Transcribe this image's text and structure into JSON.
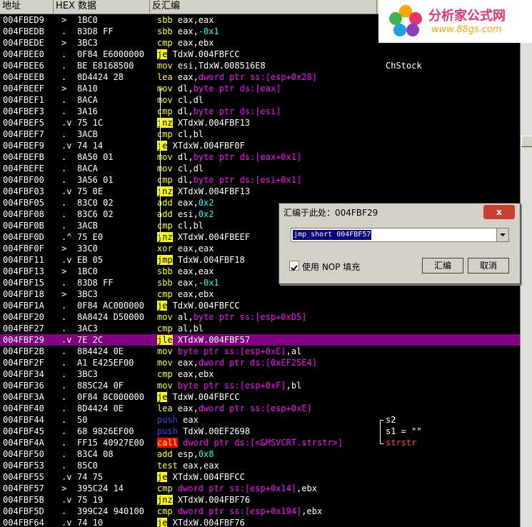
{
  "columns": {
    "address": "地址",
    "hex": "HEX 数据",
    "disasm": "反汇编",
    "comment": "注"
  },
  "logo": {
    "title": "分析家公式网",
    "url": "www.88gs.com"
  },
  "rows": [
    {
      "addr": "004FBED9",
      "mark": ">",
      "hex": "1BC0",
      "dis": [
        [
          "sbb ",
          "m"
        ],
        [
          "eax,eax",
          "w"
        ]
      ],
      "cmt": ""
    },
    {
      "addr": "004FBEDB",
      "mark": ".",
      "hex": "83D8 FF",
      "dis": [
        [
          "sbb ",
          "m"
        ],
        [
          "eax,",
          "w"
        ],
        [
          "-0x1",
          "n"
        ]
      ],
      "cmt": ""
    },
    {
      "addr": "004FBEDE",
      "mark": ">",
      "hex": "3BC3",
      "dis": [
        [
          "cmp ",
          "m"
        ],
        [
          "eax,ebx",
          "w"
        ]
      ],
      "cmt": ""
    },
    {
      "addr": "004FBEE0",
      "mark": ".",
      "hex": "0F84 E6000000",
      "dis": [
        [
          "je",
          "j"
        ],
        [
          " TdxW.004FBFCC",
          "w"
        ]
      ],
      "cmt": ""
    },
    {
      "addr": "004FBEE6",
      "mark": ".",
      "hex": "BE E8168500",
      "dis": [
        [
          "mov ",
          "m"
        ],
        [
          "esi,TdxW.008516E8",
          "w"
        ]
      ],
      "cmt": "ChStock"
    },
    {
      "addr": "004FBEEB",
      "mark": ".",
      "hex": "8D4424 28",
      "dis": [
        [
          "lea ",
          "m"
        ],
        [
          "eax,",
          "w"
        ],
        [
          "dword ptr ss:[esp+0x28]",
          "p"
        ]
      ],
      "cmt": ""
    },
    {
      "addr": "004FBEEF",
      "mark": ">",
      "hex": "8A10",
      "dis": [
        [
          "mov ",
          "m"
        ],
        [
          "dl,",
          "w"
        ],
        [
          "byte ptr ds:[eax]",
          "p"
        ]
      ],
      "cmt": ""
    },
    {
      "addr": "004FBEF1",
      "mark": ".",
      "hex": "8ACA",
      "dis": [
        [
          "mov ",
          "m"
        ],
        [
          "cl,dl",
          "w"
        ]
      ],
      "cmt": ""
    },
    {
      "addr": "004FBEF3",
      "mark": ".",
      "hex": "3A16",
      "dis": [
        [
          "cmp ",
          "m"
        ],
        [
          "dl,",
          "w"
        ],
        [
          "byte ptr ds:[esi]",
          "p"
        ]
      ],
      "cmt": ""
    },
    {
      "addr": "004FBEF5",
      "mark": ".v",
      "hex": "75 1C",
      "dis": [
        [
          "jnz",
          "j"
        ],
        [
          " XTdxW.004FBF13",
          "w"
        ]
      ],
      "cmt": ""
    },
    {
      "addr": "004FBEF7",
      "mark": ".",
      "hex": "3ACB",
      "dis": [
        [
          "cmp ",
          "m"
        ],
        [
          "cl,bl",
          "w"
        ]
      ],
      "cmt": ""
    },
    {
      "addr": "004FBEF9",
      "mark": ".v",
      "hex": "74 14",
      "dis": [
        [
          "je",
          "j"
        ],
        [
          " XTdxW.004FBF0F",
          "w"
        ]
      ],
      "cmt": ""
    },
    {
      "addr": "004FBEFB",
      "mark": ".",
      "hex": "8A50 01",
      "dis": [
        [
          "mov ",
          "m"
        ],
        [
          "dl,",
          "w"
        ],
        [
          "byte ptr ds:[eax+0x1]",
          "p"
        ]
      ],
      "cmt": ""
    },
    {
      "addr": "004FBEFE",
      "mark": ".",
      "hex": "8ACA",
      "dis": [
        [
          "mov ",
          "m"
        ],
        [
          "cl,dl",
          "w"
        ]
      ],
      "cmt": ""
    },
    {
      "addr": "004FBF00",
      "mark": ".",
      "hex": "3A56 01",
      "dis": [
        [
          "cmp ",
          "m"
        ],
        [
          "dl,",
          "w"
        ],
        [
          "byte ptr ds:[esi+0x1]",
          "p"
        ]
      ],
      "cmt": ""
    },
    {
      "addr": "004FBF03",
      "mark": ".v",
      "hex": "75 0E",
      "dis": [
        [
          "jnz",
          "j"
        ],
        [
          " XTdxW.004FBF13",
          "w"
        ]
      ],
      "cmt": ""
    },
    {
      "addr": "004FBF05",
      "mark": ".",
      "hex": "83C0 02",
      "dis": [
        [
          "add ",
          "m"
        ],
        [
          "eax,",
          "w"
        ],
        [
          "0x2",
          "n"
        ]
      ],
      "cmt": ""
    },
    {
      "addr": "004FBF08",
      "mark": ".",
      "hex": "83C6 02",
      "dis": [
        [
          "add ",
          "m"
        ],
        [
          "esi,",
          "w"
        ],
        [
          "0x2",
          "n"
        ]
      ],
      "cmt": ""
    },
    {
      "addr": "004FBF0B",
      "mark": ".",
      "hex": "3ACB",
      "dis": [
        [
          "cmp ",
          "m"
        ],
        [
          "cl,bl",
          "w"
        ]
      ],
      "cmt": ""
    },
    {
      "addr": "004FBF0D",
      "mark": ".^",
      "hex": "75 E0",
      "dis": [
        [
          "jnz",
          "j"
        ],
        [
          " XTdxW.004FBEEF",
          "w"
        ]
      ],
      "cmt": ""
    },
    {
      "addr": "004FBF0F",
      "mark": ">",
      "hex": "33C0",
      "dis": [
        [
          "xor ",
          "m"
        ],
        [
          "eax,eax",
          "w"
        ]
      ],
      "cmt": ""
    },
    {
      "addr": "004FBF11",
      "mark": ".v",
      "hex": "EB 05",
      "dis": [
        [
          "jmp",
          "j"
        ],
        [
          " TdxW.004FBF18",
          "w"
        ]
      ],
      "cmt": ""
    },
    {
      "addr": "004FBF13",
      "mark": ">",
      "hex": "1BC0",
      "dis": [
        [
          "sbb ",
          "m"
        ],
        [
          "eax,eax",
          "w"
        ]
      ],
      "cmt": ""
    },
    {
      "addr": "004FBF15",
      "mark": ".",
      "hex": "83D8 FF",
      "dis": [
        [
          "sbb ",
          "m"
        ],
        [
          "eax,",
          "w"
        ],
        [
          "-0x1",
          "n"
        ]
      ],
      "cmt": ""
    },
    {
      "addr": "004FBF18",
      "mark": ">",
      "hex": "3BC3",
      "dis": [
        [
          "cmp ",
          "m"
        ],
        [
          "eax,ebx",
          "w"
        ]
      ],
      "cmt": ""
    },
    {
      "addr": "004FBF1A",
      "mark": ".",
      "hex": "0F84 AC000000",
      "dis": [
        [
          "je",
          "j"
        ],
        [
          " TdxW.004FBFCC",
          "w"
        ]
      ],
      "cmt": ""
    },
    {
      "addr": "004FBF20",
      "mark": ".",
      "hex": "8A8424 D50000",
      "dis": [
        [
          "mov ",
          "m"
        ],
        [
          "al,",
          "w"
        ],
        [
          "byte ptr ss:[esp+0xD5]",
          "p"
        ]
      ],
      "cmt": ""
    },
    {
      "addr": "004FBF27",
      "mark": ".",
      "hex": "3AC3",
      "dis": [
        [
          "cmp ",
          "m"
        ],
        [
          "al,bl",
          "w"
        ]
      ],
      "cmt": ""
    },
    {
      "addr": "004FBF29",
      "mark": ".v",
      "hex": "7E 2C",
      "dis": [
        [
          "jle",
          "j"
        ],
        [
          " XTdxW.004FBF57",
          "w"
        ]
      ],
      "cmt": ""
    },
    {
      "addr": "004FBF2B",
      "mark": ".",
      "hex": "884424 0E",
      "dis": [
        [
          "mov ",
          "m"
        ],
        [
          "byte ptr ss:[esp+0xE]",
          "p"
        ],
        [
          ",al",
          "w"
        ]
      ],
      "cmt": ""
    },
    {
      "addr": "004FBF2F",
      "mark": ".",
      "hex": "A1 E425EF00",
      "dis": [
        [
          "mov ",
          "m"
        ],
        [
          "eax,",
          "w"
        ],
        [
          "dword ptr ds:[0xEF25E4]",
          "p"
        ]
      ],
      "cmt": ""
    },
    {
      "addr": "004FBF34",
      "mark": ".",
      "hex": "3BC3",
      "dis": [
        [
          "cmp ",
          "m"
        ],
        [
          "eax,ebx",
          "w"
        ]
      ],
      "cmt": ""
    },
    {
      "addr": "004FBF36",
      "mark": ".",
      "hex": "885C24 0F",
      "dis": [
        [
          "mov ",
          "m"
        ],
        [
          "byte ptr ss:[esp+0xF]",
          "p"
        ],
        [
          ",bl",
          "w"
        ]
      ],
      "cmt": ""
    },
    {
      "addr": "004FBF3A",
      "mark": ".",
      "hex": "0F84 8C000000",
      "dis": [
        [
          "je",
          "j"
        ],
        [
          " TdxW.004FBFCC",
          "w"
        ]
      ],
      "cmt": ""
    },
    {
      "addr": "004FBF40",
      "mark": ".",
      "hex": "8D4424 0E",
      "dis": [
        [
          "lea ",
          "m"
        ],
        [
          "eax,",
          "w"
        ],
        [
          "dword ptr ss:[esp+0xE]",
          "p"
        ]
      ],
      "cmt": ""
    },
    {
      "addr": "004FBF44",
      "mark": ".",
      "hex": "50",
      "dis": [
        [
          "push ",
          "u"
        ],
        [
          "eax",
          "w"
        ]
      ],
      "cmt": "s2"
    },
    {
      "addr": "004FBF45",
      "mark": ".",
      "hex": "68 9826EF00",
      "dis": [
        [
          "push ",
          "u"
        ],
        [
          "TdxW.00EF2698",
          "w"
        ]
      ],
      "cmt": "s1 = \"\""
    },
    {
      "addr": "004FBF4A",
      "mark": ".",
      "hex": "FF15 40927E00",
      "dis": [
        [
          "call",
          "c"
        ],
        [
          " dword ptr ds:[<&MSVCRT.strstr>]",
          "p"
        ]
      ],
      "cmt": "strstr"
    },
    {
      "addr": "004FBF50",
      "mark": ".",
      "hex": "83C4 08",
      "dis": [
        [
          "add ",
          "m"
        ],
        [
          "esp,",
          "w"
        ],
        [
          "0x8",
          "n"
        ]
      ],
      "cmt": ""
    },
    {
      "addr": "004FBF53",
      "mark": ".",
      "hex": "85C0",
      "dis": [
        [
          "test ",
          "m"
        ],
        [
          "eax,eax",
          "w"
        ]
      ],
      "cmt": ""
    },
    {
      "addr": "004FBF55",
      "mark": ".v",
      "hex": "74 75",
      "dis": [
        [
          "je",
          "j"
        ],
        [
          " XTdxW.004FBFCC",
          "w"
        ]
      ],
      "cmt": ""
    },
    {
      "addr": "004FBF57",
      "mark": ">",
      "hex": "395C24 14",
      "dis": [
        [
          "cmp ",
          "m"
        ],
        [
          "dword ptr ss:[esp+0x14]",
          "p"
        ],
        [
          ",ebx",
          "w"
        ]
      ],
      "cmt": ""
    },
    {
      "addr": "004FBF5B",
      "mark": ".v",
      "hex": "75 19",
      "dis": [
        [
          "jnz",
          "j"
        ],
        [
          " XTdxW.004FBF76",
          "w"
        ]
      ],
      "cmt": ""
    },
    {
      "addr": "004FBF5D",
      "mark": ".",
      "hex": "399C24 940100",
      "dis": [
        [
          "cmp ",
          "m"
        ],
        [
          "dword ptr ss:[esp+0x194]",
          "p"
        ],
        [
          ",ebx",
          "w"
        ]
      ],
      "cmt": ""
    },
    {
      "addr": "004FBF64",
      "mark": ".v",
      "hex": "74 10",
      "dis": [
        [
          "je",
          "j"
        ],
        [
          " XTdxW.004FBF76",
          "w"
        ]
      ],
      "cmt": ""
    }
  ],
  "selected_row": 28,
  "dialog": {
    "title": "汇编于此处：004FBF29",
    "input_value": "jmp short 004FBF57",
    "nop_label": "使用 NOP 填充",
    "assemble_button": "汇编",
    "cancel_button": "取消",
    "close_label": "x"
  },
  "colors": {
    "mnemonic": "#ffff00",
    "jump_bg": "#ffff00",
    "jump_fg": "#000000",
    "call_bg": "#ff0000",
    "push": "#4040ff",
    "operand": "#ffffff",
    "number": "#00ffff",
    "pointer": "#ff00ff",
    "selection": "#800080"
  }
}
